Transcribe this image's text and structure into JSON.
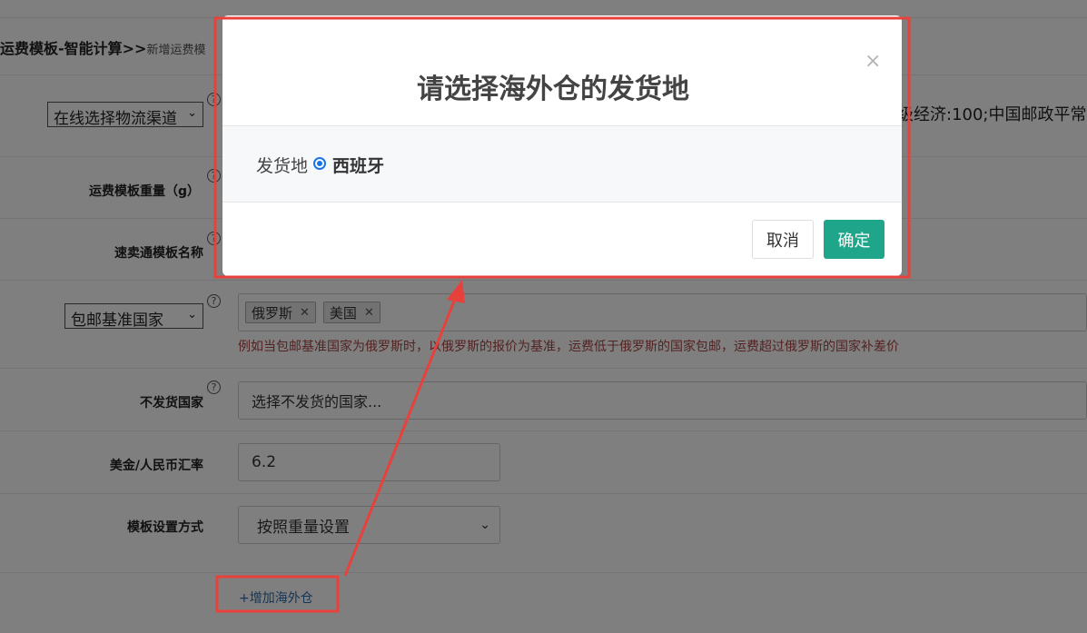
{
  "background": {
    "breadcrumb_main": "运费模板-智能计算>>",
    "breadcrumb_sub": "新增运费模",
    "channel_select": "在线选择物流渠道",
    "channel_right_text": "级经济:100;中国邮政平常小",
    "weight_label": "运费模板重量（g）",
    "name_label": "速卖通模板名称",
    "free_country_select": "包邮基准国家",
    "free_country_tags": [
      "俄罗斯",
      "美国"
    ],
    "free_country_hint": "例如当包邮基准国家为俄罗斯时，以俄罗斯的报价为基准，运费低于俄罗斯的国家包邮，运费超过俄罗斯的国家补差价",
    "no_ship_label": "不发货国家",
    "no_ship_placeholder": "选择不发货的国家...",
    "rate_label": "美金/人民币汇率",
    "rate_value": "6.2",
    "mode_label": "模板设置方式",
    "mode_value": "按照重量设置",
    "add_warehouse_link": "+增加海外仓",
    "help_glyph": "?",
    "select_chevron": "⌄",
    "tag_remove_glyph": "✕"
  },
  "modal": {
    "title": "请选择海外仓的发货地",
    "close_glyph": "×",
    "ship_from_label": "发货地",
    "option_label": "西班牙",
    "cancel_label": "取消",
    "ok_label": "确定"
  },
  "colors": {
    "overlay": "rgba(0,0,0,0.5)",
    "primary_button": "#1fa68a",
    "annotation": "#e8413b",
    "radio": "#1a73e8",
    "hint_text": "#a94442",
    "link": "#2f6aa7"
  }
}
